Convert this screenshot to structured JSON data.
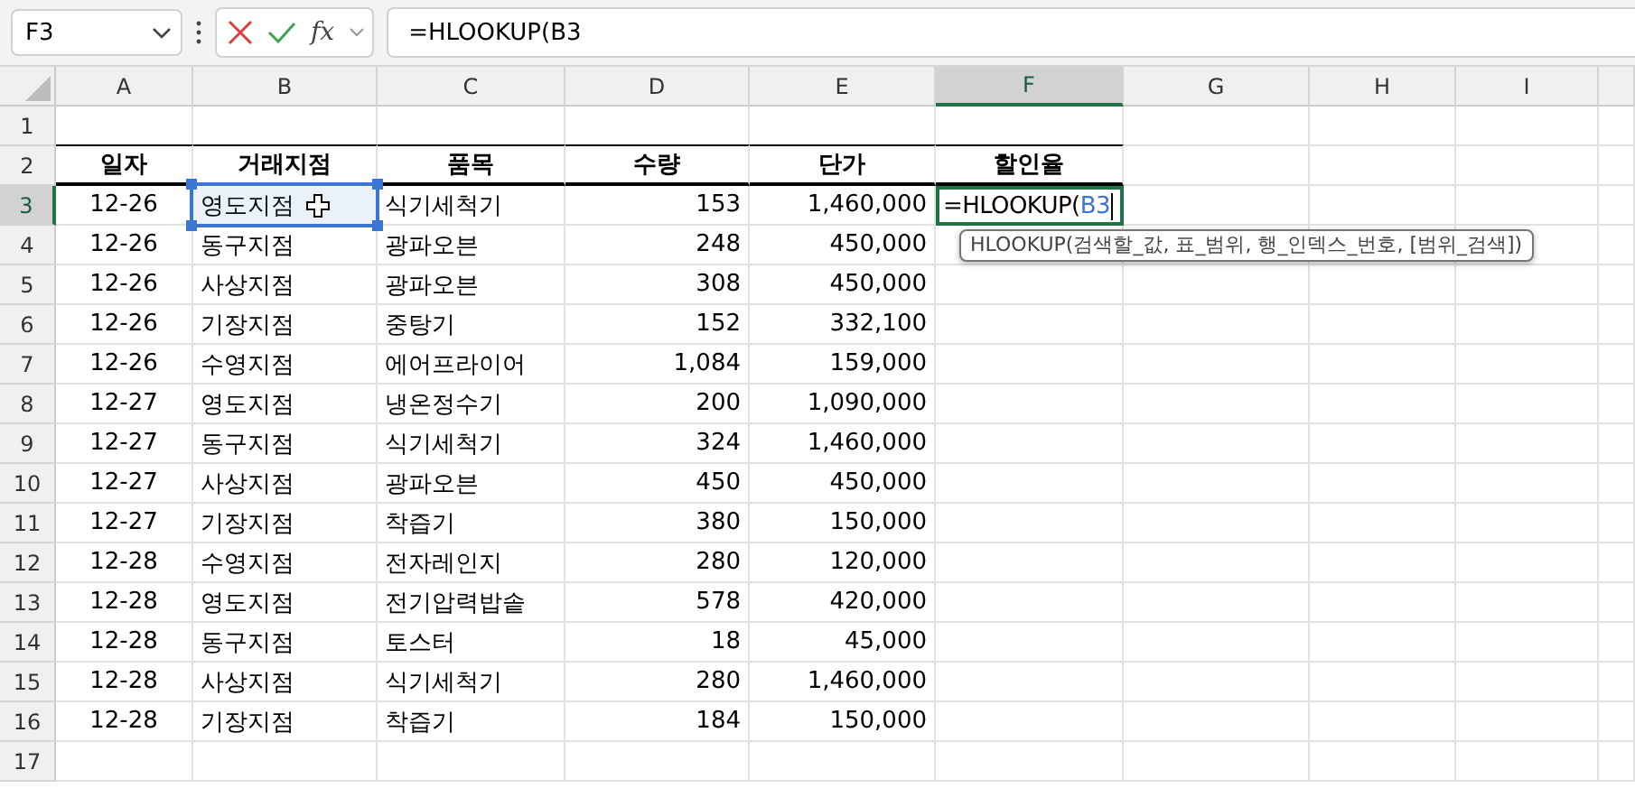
{
  "formula_bar": {
    "name_box": "F3",
    "function_label": "fx",
    "formula": "=HLOOKUP(B3"
  },
  "columns": [
    {
      "label": "A",
      "selected": false
    },
    {
      "label": "B",
      "selected": false
    },
    {
      "label": "C",
      "selected": false
    },
    {
      "label": "D",
      "selected": false
    },
    {
      "label": "E",
      "selected": false
    },
    {
      "label": "F",
      "selected": true
    },
    {
      "label": "G",
      "selected": false
    },
    {
      "label": "H",
      "selected": false
    },
    {
      "label": "I",
      "selected": false
    }
  ],
  "rows": [
    {
      "number": "1",
      "selected": false,
      "kind": "empty",
      "cells": []
    },
    {
      "number": "2",
      "selected": false,
      "kind": "header",
      "cells": [
        "일자",
        "거래지점",
        "품목",
        "수량",
        "단가",
        "할인율"
      ]
    },
    {
      "number": "3",
      "selected": true,
      "kind": "data",
      "cells": [
        "12-26",
        "영도지점",
        "식기세척기",
        "153",
        "1,460,000"
      ],
      "range_highlighted": true,
      "editing_cell": {
        "text": "=HLOOKUP(",
        "reference": "B3",
        "tooltip": "HLOOKUP(검색할_값, 표_범위, 행_인덱스_번호, [범위_검색])"
      }
    },
    {
      "number": "4",
      "selected": false,
      "kind": "data",
      "cells": [
        "12-26",
        "동구지점",
        "광파오븐",
        "248",
        "450,000"
      ]
    },
    {
      "number": "5",
      "selected": false,
      "kind": "data",
      "cells": [
        "12-26",
        "사상지점",
        "광파오븐",
        "308",
        "450,000"
      ]
    },
    {
      "number": "6",
      "selected": false,
      "kind": "data",
      "cells": [
        "12-26",
        "기장지점",
        "중탕기",
        "152",
        "332,100"
      ]
    },
    {
      "number": "7",
      "selected": false,
      "kind": "data",
      "cells": [
        "12-26",
        "수영지점",
        "에어프라이어",
        "1,084",
        "159,000"
      ]
    },
    {
      "number": "8",
      "selected": false,
      "kind": "data",
      "cells": [
        "12-27",
        "영도지점",
        "냉온정수기",
        "200",
        "1,090,000"
      ]
    },
    {
      "number": "9",
      "selected": false,
      "kind": "data",
      "cells": [
        "12-27",
        "동구지점",
        "식기세척기",
        "324",
        "1,460,000"
      ]
    },
    {
      "number": "10",
      "selected": false,
      "kind": "data",
      "cells": [
        "12-27",
        "사상지점",
        "광파오븐",
        "450",
        "450,000"
      ]
    },
    {
      "number": "11",
      "selected": false,
      "kind": "data",
      "cells": [
        "12-27",
        "기장지점",
        "착즙기",
        "380",
        "150,000"
      ]
    },
    {
      "number": "12",
      "selected": false,
      "kind": "data",
      "cells": [
        "12-28",
        "수영지점",
        "전자레인지",
        "280",
        "120,000"
      ]
    },
    {
      "number": "13",
      "selected": false,
      "kind": "data",
      "cells": [
        "12-28",
        "영도지점",
        "전기압력밥솥",
        "578",
        "420,000"
      ]
    },
    {
      "number": "14",
      "selected": false,
      "kind": "data",
      "cells": [
        "12-28",
        "동구지점",
        "토스터",
        "18",
        "45,000"
      ]
    },
    {
      "number": "15",
      "selected": false,
      "kind": "data",
      "cells": [
        "12-28",
        "사상지점",
        "식기세척기",
        "280",
        "1,460,000"
      ]
    },
    {
      "number": "16",
      "selected": false,
      "kind": "data",
      "cells": [
        "12-28",
        "기장지점",
        "착즙기",
        "184",
        "150,000"
      ]
    },
    {
      "number": "17",
      "selected": false,
      "kind": "empty",
      "cells": []
    }
  ]
}
